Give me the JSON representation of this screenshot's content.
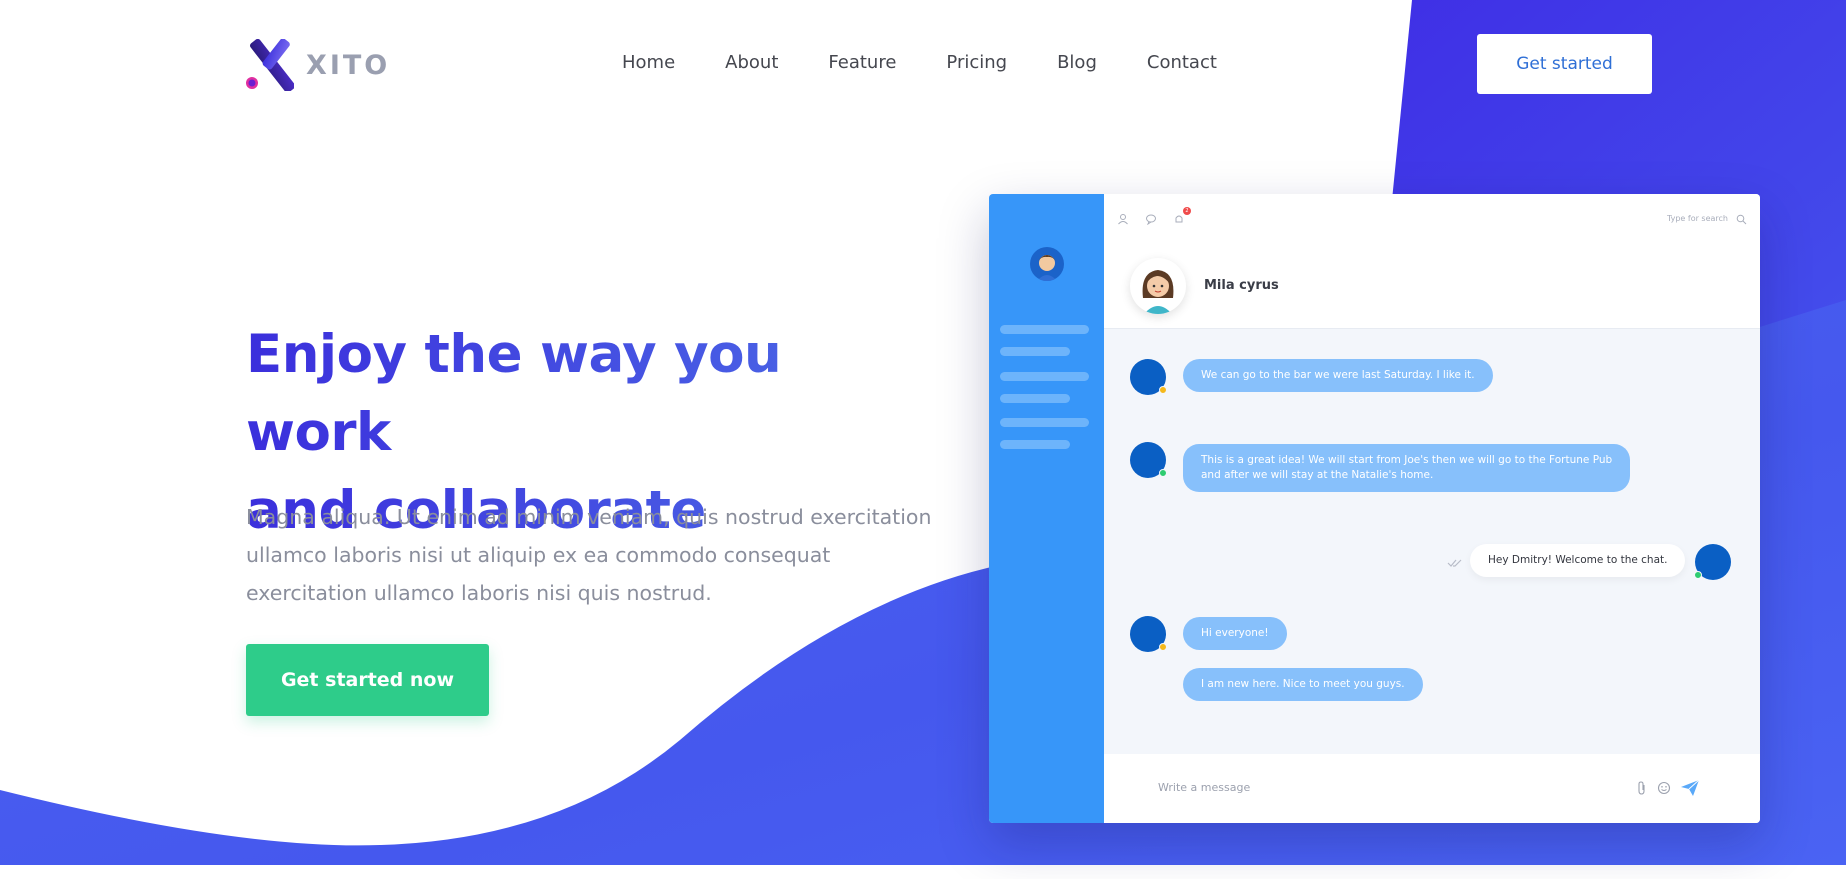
{
  "brand": {
    "name": "XITO"
  },
  "nav": {
    "items": [
      "Home",
      "About",
      "Feature",
      "Pricing",
      "Blog",
      "Contact"
    ]
  },
  "header": {
    "cta_label": "Get started"
  },
  "hero": {
    "title_line1": "Enjoy the way you work",
    "title_line2": "and collaborate",
    "subtitle": "Magna aliqua. Ut enim ad minim veniam, quis nostrud exercitation ullamco laboris nisi ut aliquip ex ea commodo consequat exercitation ullamco laboris nisi quis nostrud.",
    "cta_label": "Get started now"
  },
  "chat": {
    "search_placeholder": "Type for search",
    "notification_count": "2",
    "contact_name": "Mila cyrus",
    "messages": [
      {
        "text": "We can go to the bar we were last Saturday. I like it.",
        "direction": "in",
        "status_color": "#f5b91c"
      },
      {
        "text": "This is a great idea! We will start from Joe's then we will go to the Fortune Pub\nand after we will stay at the Natalie's home.",
        "direction": "in",
        "status_color": "#2ecc71"
      },
      {
        "text": "Hey Dmitry! Welcome to the chat.",
        "direction": "out",
        "status_color": "#2ecc71"
      },
      {
        "text": "Hi everyone!",
        "direction": "in",
        "status_color": "#f5b91c"
      },
      {
        "text": "I am new here. Nice to meet you guys.",
        "direction": "in",
        "status_color": ""
      }
    ],
    "input_placeholder": "Write a message",
    "icons": [
      "user-icon",
      "chat-icon",
      "bell-icon",
      "search-icon",
      "attachment-icon",
      "emoji-icon",
      "send-icon",
      "read-check-icon"
    ]
  },
  "colors": {
    "accent": "#3b2fdc",
    "wave": "#4a5ff0",
    "cta_green": "#2ecc8a",
    "chat_sidebar": "#3796f9",
    "bubble_in": "#87c0fb"
  }
}
